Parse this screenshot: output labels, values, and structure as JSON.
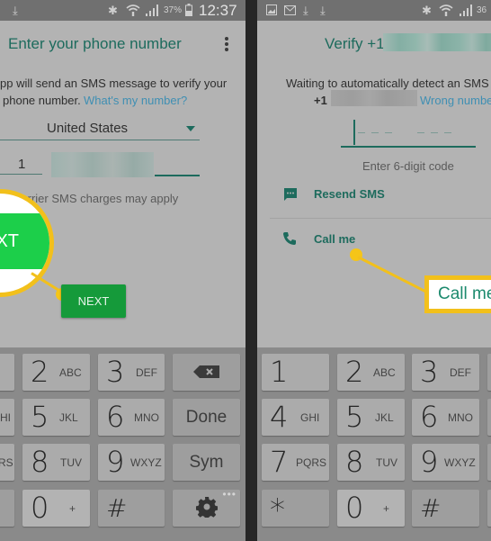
{
  "left": {
    "status_bar": {
      "battery_percent": "37%",
      "time": "12:37",
      "icons": [
        "download-icon",
        "bluetooth-icon",
        "wifi-icon",
        "signal-icon",
        "battery-icon"
      ]
    },
    "app_bar": {
      "title": "Enter your phone number",
      "menu_icon": "overflow-menu-icon"
    },
    "body": {
      "intro_line1": "pp will send an SMS message to verify your",
      "intro_line2": "phone number.",
      "intro_link": "What's my number?",
      "country_select": "United States",
      "country_code": "1",
      "phone_number_value": "",
      "carrier_note": "Carrier SMS charges may apply",
      "next_button": "NEXT"
    },
    "callout": {
      "zoom_label": "XT"
    },
    "keyboard": {
      "rows": [
        [
          {
            "num": "",
            "sub": ""
          },
          {
            "num": "2",
            "sub": "ABC"
          },
          {
            "num": "3",
            "sub": "DEF"
          },
          {
            "word": "backspace"
          }
        ],
        [
          {
            "num": "",
            "sub": "HI"
          },
          {
            "num": "5",
            "sub": "JKL"
          },
          {
            "num": "6",
            "sub": "MNO"
          },
          {
            "word": "Done"
          }
        ],
        [
          {
            "num": "",
            "sub": "RS"
          },
          {
            "num": "8",
            "sub": "TUV"
          },
          {
            "num": "9",
            "sub": "WXYZ"
          },
          {
            "word": "Sym"
          }
        ],
        [
          {
            "num": "",
            "sub": ""
          },
          {
            "num": "0",
            "sub": "+"
          },
          {
            "num": "#",
            "sub": ""
          },
          {
            "word": "settings"
          }
        ]
      ]
    }
  },
  "right": {
    "status_bar": {
      "battery_percent": "36",
      "icons": [
        "gallery-icon",
        "mail-icon",
        "download-icon",
        "download-icon",
        "bluetooth-icon",
        "wifi-icon",
        "signal-icon"
      ]
    },
    "app_bar": {
      "title": "Verify +1"
    },
    "body": {
      "waiting_text": "Waiting to automatically detect an SMS",
      "number_prefix": "+1",
      "wrong_number_link": "Wrong numbe",
      "code_hint": "Enter 6-digit code",
      "resend_sms": "Resend SMS",
      "call_me": "Call me"
    },
    "callout": {
      "label": "Call me"
    },
    "keyboard": {
      "rows": [
        [
          {
            "num": "1",
            "sub": ""
          },
          {
            "num": "2",
            "sub": "ABC"
          },
          {
            "num": "3",
            "sub": "DEF"
          }
        ],
        [
          {
            "num": "4",
            "sub": "GHI"
          },
          {
            "num": "5",
            "sub": "JKL"
          },
          {
            "num": "6",
            "sub": "MNO"
          }
        ],
        [
          {
            "num": "7",
            "sub": "PQRS"
          },
          {
            "num": "8",
            "sub": "TUV"
          },
          {
            "num": "9",
            "sub": "WXYZ"
          }
        ],
        [
          {
            "num": "*",
            "sub": ""
          },
          {
            "num": "0",
            "sub": "+"
          },
          {
            "num": "#",
            "sub": ""
          }
        ]
      ]
    }
  },
  "colors": {
    "accent_teal": "#1d6b5d",
    "link_blue": "#3f8fb3",
    "next_green": "#159a3a",
    "callout_yellow": "#f2c01b"
  }
}
